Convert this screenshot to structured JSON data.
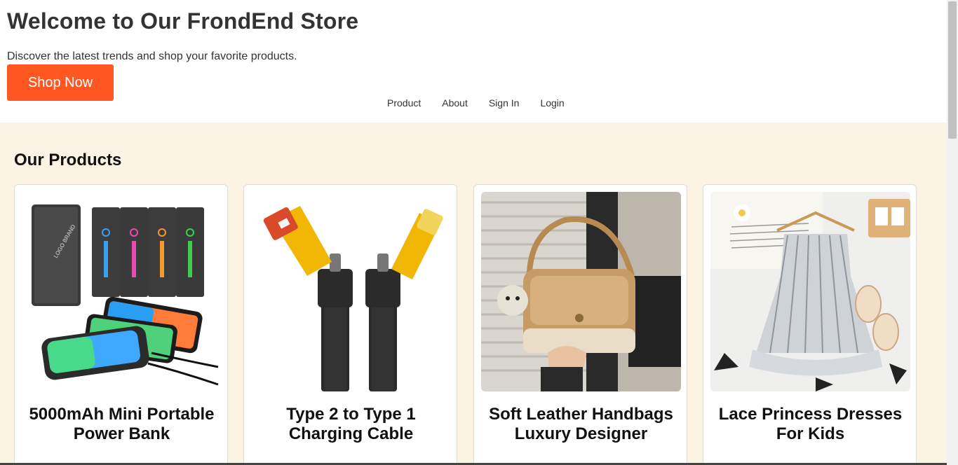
{
  "header": {
    "title": "Welcome to Our FrondEnd Store",
    "subtitle": "Discover the latest trends and shop your favorite products.",
    "cta_label": "Shop Now",
    "cta_color": "#ff5722"
  },
  "nav": {
    "items": [
      {
        "label": "Product"
      },
      {
        "label": "About"
      },
      {
        "label": "Sign In"
      },
      {
        "label": "Login"
      }
    ]
  },
  "products": {
    "title": "Our Products",
    "background": "#fbf3e4",
    "items": [
      {
        "name": "5000mAh Mini Portable Power Bank",
        "image": "power-bank-image"
      },
      {
        "name": "Type 2 to Type 1 Charging Cable",
        "image": "charging-cable-image"
      },
      {
        "name": "Soft Leather Handbags Luxury Designer",
        "image": "handbag-image"
      },
      {
        "name": "Lace Princess Dresses For Kids",
        "image": "kids-dress-image"
      }
    ]
  }
}
